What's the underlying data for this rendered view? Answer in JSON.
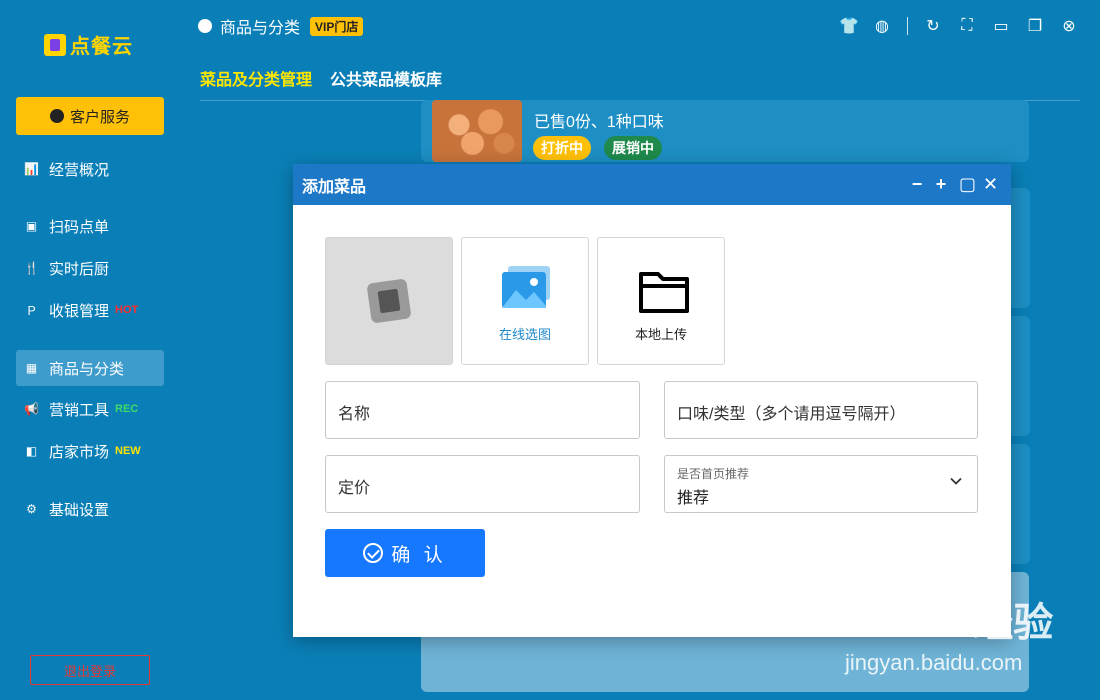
{
  "app": {
    "logo_text": "点餐云"
  },
  "sidebar": {
    "service_label": "客户服务",
    "items": [
      {
        "label": "经营概况",
        "icon": "chart-icon",
        "tag": ""
      },
      {
        "label": "扫码点单",
        "icon": "scan-icon",
        "tag": ""
      },
      {
        "label": "实时后厨",
        "icon": "cutlery-icon",
        "tag": ""
      },
      {
        "label": "收银管理",
        "icon": "paypal-icon",
        "tag": "HOT"
      },
      {
        "label": "商品与分类",
        "icon": "grid-icon",
        "tag": ""
      },
      {
        "label": "营销工具",
        "icon": "megaphone-icon",
        "tag": "REC"
      },
      {
        "label": "店家市场",
        "icon": "market-icon",
        "tag": "NEW"
      },
      {
        "label": "基础设置",
        "icon": "gears-icon",
        "tag": ""
      }
    ],
    "active_index": 4,
    "logout_label": "退出登录"
  },
  "header": {
    "title": "商品与分类",
    "vip_label": "VIP门店",
    "tabs": [
      "菜品及分类管理",
      "公共菜品模板库"
    ],
    "active_tab": 0
  },
  "product": {
    "sold_text": "已售0份、1种口味",
    "badge_discount": "打折中",
    "badge_promo": "展销中"
  },
  "modal": {
    "title": "添加菜品",
    "tile_online_label": "在线选图",
    "tile_local_label": "本地上传",
    "name_placeholder": "名称",
    "taste_placeholder": "口味/类型（多个请用逗号隔开）",
    "price_placeholder": "定价",
    "recommend_label": "是否首页推荐",
    "recommend_value": "推荐",
    "confirm_label": "确 认"
  },
  "watermark": {
    "brand": "Baidu经验",
    "url": "jingyan.baidu.com"
  },
  "colors": {
    "accent": "#0a7fb7",
    "primary": "#1677ff",
    "highlight": "#ffc107",
    "modal_header": "#1e78c8"
  }
}
